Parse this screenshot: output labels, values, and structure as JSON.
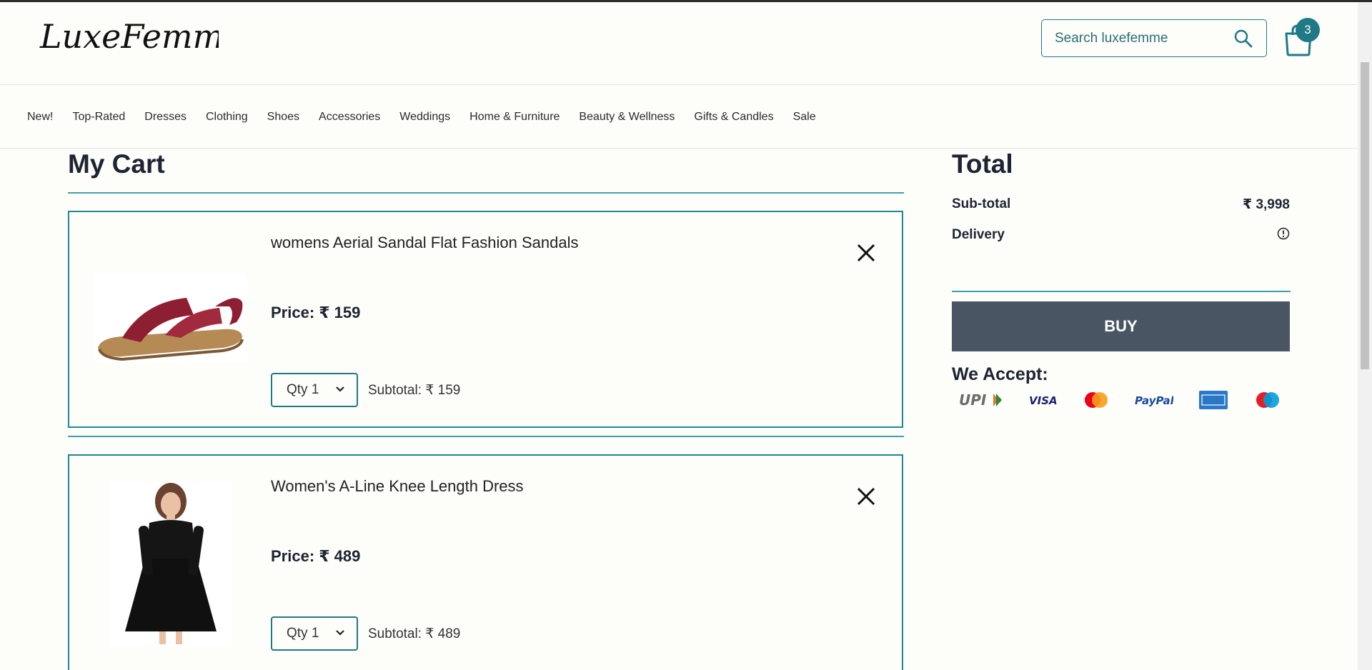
{
  "header": {
    "logo_text": "LuxeFemme",
    "search_placeholder": "Search luxefemme",
    "cart_count": "3"
  },
  "nav": {
    "items": [
      "New!",
      "Top-Rated",
      "Dresses",
      "Clothing",
      "Shoes",
      "Accessories",
      "Weddings",
      "Home & Furniture",
      "Beauty & Wellness",
      "Gifts & Candles",
      "Sale"
    ]
  },
  "cart": {
    "title": "My Cart",
    "items": [
      {
        "name": "womens Aerial Sandal Flat Fashion Sandals",
        "price": "Price: ₹ 159",
        "qty": "Qty 1",
        "subtotal": "Subtotal: ₹ 159"
      },
      {
        "name": "Women's A-Line Knee Length Dress",
        "price": "Price: ₹ 489",
        "qty": "Qty 1",
        "subtotal": "Subtotal: ₹ 489"
      }
    ]
  },
  "summary": {
    "title": "Total",
    "subtotal_label": "Sub-total",
    "subtotal_value": "₹ 3,998",
    "delivery_label": "Delivery",
    "buy_label": "BUY",
    "accept_title": "We Accept:",
    "payment_methods": [
      "UPI",
      "VISA",
      "MasterCard",
      "PayPal",
      "American Express",
      "Maestro"
    ]
  },
  "colors": {
    "accent": "#1f7a86",
    "buy_button": "#4a5564",
    "background": "#fdfdf9"
  }
}
